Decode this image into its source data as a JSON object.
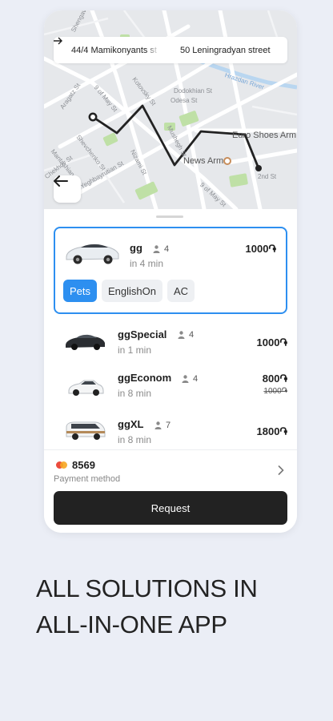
{
  "route": {
    "from": "44/4 Mamikonyants st",
    "to": "50 Leningradyan street"
  },
  "map": {
    "labels": [
      "Shengav",
      "Dodokhian St",
      "Odesa St",
      "Kotovsky St",
      "9 of May St",
      "Aragatz St",
      "Shevchenko St",
      "Mantashian St",
      "Mushegh St",
      "Euro Shoes Arm",
      "News Arm",
      "2nd St",
      "Nizami St",
      "Chekhov St",
      "Yeghbayrutian St",
      "9 of May St",
      "Hrazdan River"
    ]
  },
  "selected_ride": {
    "name": "gg",
    "seats": "4",
    "eta": "in 4 min",
    "price": "1000֏",
    "options": [
      "Pets",
      "EnglishOn",
      "AC"
    ]
  },
  "rides": [
    {
      "name": "ggSpecial",
      "seats": "4",
      "eta": "in 1 min",
      "price": "1000֏",
      "old_price": ""
    },
    {
      "name": "ggEconom",
      "seats": "4",
      "eta": "in 8 min",
      "price": "800֏",
      "old_price": "1000֏"
    },
    {
      "name": "ggXL",
      "seats": "7",
      "eta": "in 8 min",
      "price": "1800֏",
      "old_price": ""
    }
  ],
  "payment": {
    "card": "8569",
    "label": "Payment method"
  },
  "request_label": "Request",
  "headline": [
    "ALL SOLUTIONS IN",
    "ALL-IN-ONE APP"
  ],
  "colors": {
    "accent": "#2d8ff0",
    "button": "#222222",
    "background": "#ebeef6",
    "route": "#222222",
    "park": "#bfe0a6",
    "mastercard_red": "#eb4b3c",
    "mastercard_orange": "#f6a622"
  },
  "icons": [
    "arrow-right-icon",
    "back-arrow-icon",
    "seat-person-icon",
    "chevron-right-icon",
    "card-brand-icon",
    "car-icon"
  ]
}
